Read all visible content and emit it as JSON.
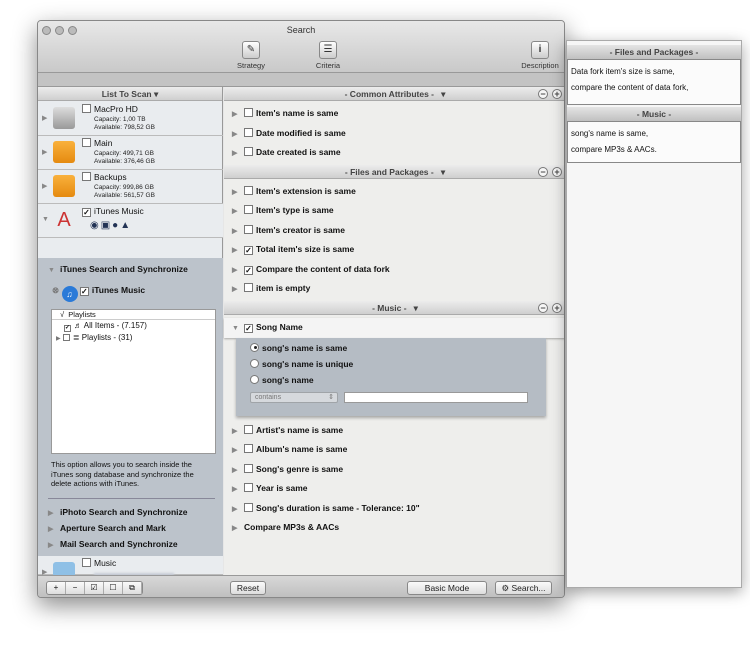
{
  "window": {
    "title": "Search"
  },
  "toolbar": {
    "strategy": "Strategy",
    "criteria": "Criteria",
    "description": "Description"
  },
  "left": {
    "header": "List To Scan",
    "volumes": [
      {
        "name": "MacPro HD",
        "capacity": "Capacity: 1,00 TB",
        "available": "Available: 798,52 GB",
        "checked": false
      },
      {
        "name": "Main",
        "capacity": "Capacity: 499,71 GB",
        "available": "Available: 376,46 GB",
        "checked": false
      },
      {
        "name": "Backups",
        "capacity": "Capacity: 999,86 GB",
        "available": "Available: 561,57 GB",
        "checked": false
      }
    ],
    "itunes_row": "iTunes Music",
    "itunes_section": "iTunes Search and Synchronize",
    "itunes_music": "iTunes Music",
    "playlists_col_check": "√",
    "playlists_col": "Playlists",
    "playlists": [
      {
        "label": "All Items - (7.157)",
        "checked": true
      },
      {
        "label": "Playlists - (31)",
        "checked": false
      }
    ],
    "info": "This option allows you to search inside the iTunes song database and synchronize the delete actions with iTunes.",
    "other_sections": [
      "iPhoto Search and Synchronize",
      "Aperture Search and Mark",
      "Mail Search and Synchronize"
    ],
    "music_folder": "Music",
    "bottom_buttons": [
      "+",
      "−",
      "☑",
      "☐",
      "⧉"
    ]
  },
  "right": {
    "groups": [
      {
        "title": "- Common Attributes -",
        "items": [
          {
            "label": "Item's name is same",
            "checked": false
          },
          {
            "label": "Date modified is same",
            "checked": false
          },
          {
            "label": "Date created is same",
            "checked": false
          }
        ]
      },
      {
        "title": "- Files and Packages -",
        "items": [
          {
            "label": "Item's extension is same",
            "checked": false
          },
          {
            "label": "Item's type is same",
            "checked": false
          },
          {
            "label": "Item's creator is same",
            "checked": false
          },
          {
            "label": "Total item's size is same",
            "checked": true
          },
          {
            "label": "Compare the content of data fork",
            "checked": true
          },
          {
            "label": "item is empty",
            "checked": false
          }
        ]
      },
      {
        "title": "- Music -",
        "song_name": "Song Name",
        "options": [
          "song's name is same",
          "song's name is unique",
          "song's name"
        ],
        "select": "contains",
        "items": [
          {
            "label": "Artist's name is same",
            "checked": false
          },
          {
            "label": "Album's name is same",
            "checked": false
          },
          {
            "label": "Song's genre is same",
            "checked": false
          },
          {
            "label": "Year is same",
            "checked": false
          },
          {
            "label": "Song's duration is same - Tolerance: 10\"",
            "checked": false
          },
          {
            "label": "Compare MP3s & AACs"
          }
        ]
      }
    ],
    "reset": "Reset",
    "basic_mode": "Basic Mode",
    "search": "Search..."
  },
  "description_panel": {
    "files_title": "- Files and Packages -",
    "files_lines": [
      "Data fork item's size is same,",
      "compare the content of data fork,"
    ],
    "music_title": "- Music -",
    "music_lines": [
      "song's name is same,",
      "compare MP3s & AACs."
    ]
  }
}
